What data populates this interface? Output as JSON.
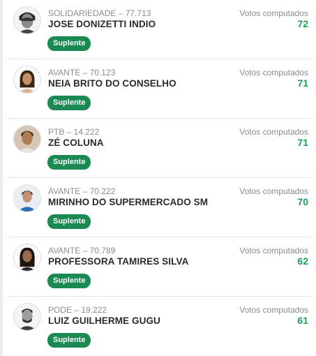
{
  "candidates": [
    {
      "party_line": "SOLIDARIEDADE – 77.713",
      "name": "JOSE DONIZETTI INDIO",
      "status": "Suplente",
      "votes_label": "Votos computados",
      "votes": "72",
      "avatar_icon": "candidate-photo-icon"
    },
    {
      "party_line": "AVANTE – 70.123",
      "name": "NEIA BRITO DO CONSELHO",
      "status": "Suplente",
      "votes_label": "Votos computados",
      "votes": "71",
      "avatar_icon": "candidate-photo-icon"
    },
    {
      "party_line": "PTB – 14.222",
      "name": "ZÉ COLUNA",
      "status": "Suplente",
      "votes_label": "Votos computados",
      "votes": "71",
      "avatar_icon": "candidate-photo-icon"
    },
    {
      "party_line": "AVANTE – 70.222",
      "name": "MIRINHO DO SUPERMERCADO SM",
      "status": "Suplente",
      "votes_label": "Votos computados",
      "votes": "70",
      "avatar_icon": "candidate-photo-icon"
    },
    {
      "party_line": "AVANTE – 70.789",
      "name": "PROFESSORA TAMIRES SILVA",
      "status": "Suplente",
      "votes_label": "Votos computados",
      "votes": "62",
      "avatar_icon": "candidate-photo-icon"
    },
    {
      "party_line": "PODE – 19.222",
      "name": "LUIZ GUILHERME GUGU",
      "status": "Suplente",
      "votes_label": "Votos computados",
      "votes": "61",
      "avatar_icon": "candidate-photo-icon"
    }
  ],
  "colors": {
    "badge_background": "#1a8a52",
    "votes_value": "#1a9e5c",
    "muted_text": "#8c8c8c",
    "name_text": "#2b2b2b"
  }
}
